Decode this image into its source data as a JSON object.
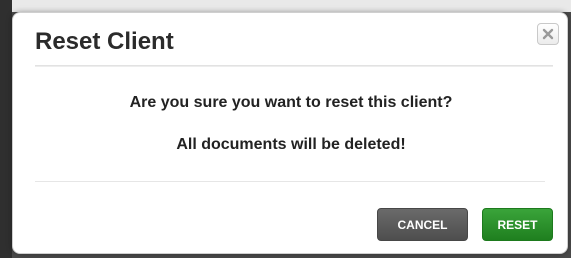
{
  "dialog": {
    "title": "Reset Client",
    "close_icon": "close-icon",
    "message_primary": "Are you sure you want to reset this client?",
    "message_secondary": "All documents will be deleted!",
    "buttons": {
      "cancel_label": "CANCEL",
      "reset_label": "RESET"
    },
    "colors": {
      "cancel_button": "#555555",
      "reset_button": "#2a8f2a"
    }
  }
}
